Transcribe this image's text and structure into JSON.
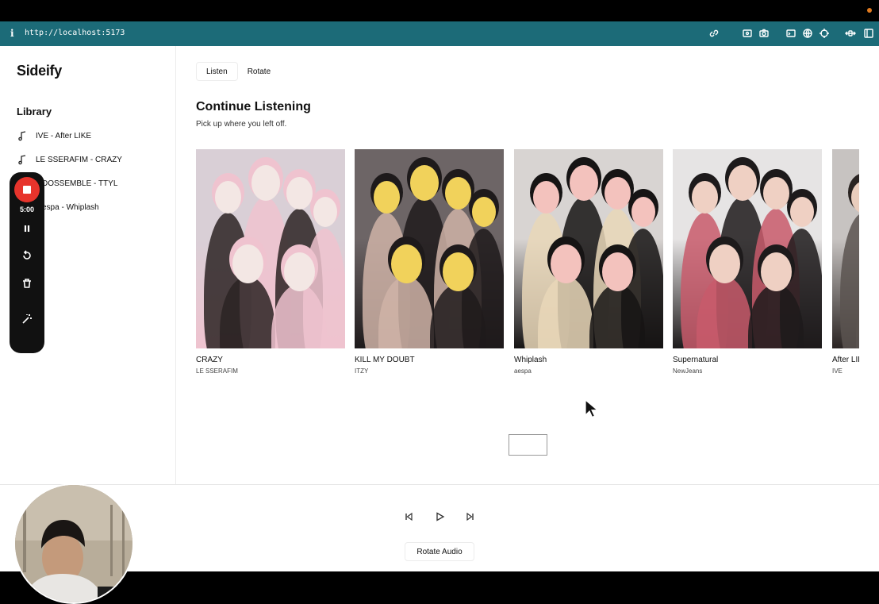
{
  "browser": {
    "info_glyph": "i",
    "url": "http://localhost:5173"
  },
  "sidebar": {
    "brand": "Sideify",
    "library_title": "Library",
    "items": [
      {
        "label": "IVE - After LIKE"
      },
      {
        "label": "LE SSERAFIM - CRAZY"
      },
      {
        "label": "tripleS VISIONARY VOSSEMBLE - TTYL"
      },
      {
        "label": "aespa - Whiplash"
      }
    ],
    "items_visible": [
      "IVE - After LIKE",
      "LE SSERAFIM - CRAZY",
      "DOSSEMBLE - TTYL",
      "espa - Whiplash"
    ]
  },
  "recorder": {
    "timer": "5:00"
  },
  "main": {
    "tabs": [
      {
        "label": "Listen"
      },
      {
        "label": "Rotate"
      }
    ],
    "heading": "Continue Listening",
    "subheading": "Pick up where you left off.",
    "cards": [
      {
        "title": "CRAZY",
        "artist": "LE SSERAFIM",
        "palette": [
          "#d9cfd6",
          "#efc3cf",
          "#f3e7e4",
          "#2b2323"
        ]
      },
      {
        "title": "KILL MY DOUBT",
        "artist": "ITZY",
        "palette": [
          "#6d6566",
          "#1e1a1b",
          "#f1d25b",
          "#cfb3a7"
        ]
      },
      {
        "title": "Whiplash",
        "artist": "aespa",
        "palette": [
          "#d8d4d2",
          "#161414",
          "#f3c2bd",
          "#e9d7b8"
        ]
      },
      {
        "title": "Supernatural",
        "artist": "NewJeans",
        "palette": [
          "#e6e4e4",
          "#1d1a1b",
          "#efd0c3",
          "#c85b6b"
        ]
      },
      {
        "title": "After LIKE",
        "artist": "IVE",
        "palette": [
          "#c7c3c1",
          "#2a2422",
          "#e9cdbd",
          "#5a5350"
        ]
      }
    ]
  },
  "player": {
    "rotate_label": "Rotate Audio"
  },
  "colors": {
    "url_bar": "#1c6b78",
    "record_red": "#e7342c",
    "record_bar": "#111111"
  }
}
